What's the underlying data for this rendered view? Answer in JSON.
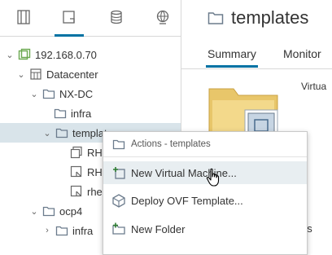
{
  "navigator": {
    "tabs": [
      {
        "icon": "hosts-and-clusters-icon"
      },
      {
        "icon": "vms-and-templates-icon"
      },
      {
        "icon": "storage-icon"
      },
      {
        "icon": "networking-icon"
      }
    ],
    "tree": [
      {
        "label": "192.168.0.70"
      },
      {
        "label": "Datacenter"
      },
      {
        "label": "NX-DC"
      },
      {
        "label": "infra"
      },
      {
        "label": "templates"
      },
      {
        "label": "RH"
      },
      {
        "label": "RH"
      },
      {
        "label": "rhe"
      },
      {
        "label": "ocp4"
      },
      {
        "label": "infra"
      }
    ]
  },
  "main": {
    "title": "templates",
    "tabs": [
      {
        "label": "Summary"
      },
      {
        "label": "Monitor"
      }
    ],
    "partial_text": "Virtua",
    "partial_text_2": "es"
  },
  "context_menu": {
    "header": "Actions - templates",
    "items": [
      {
        "label": "New Virtual Machine..."
      },
      {
        "label": "Deploy OVF Template..."
      },
      {
        "label": "New Folder"
      }
    ]
  },
  "colors": {
    "accent": "#0072a3",
    "selected_row": "#d9e4ea",
    "folder": "#6b7b8c"
  }
}
